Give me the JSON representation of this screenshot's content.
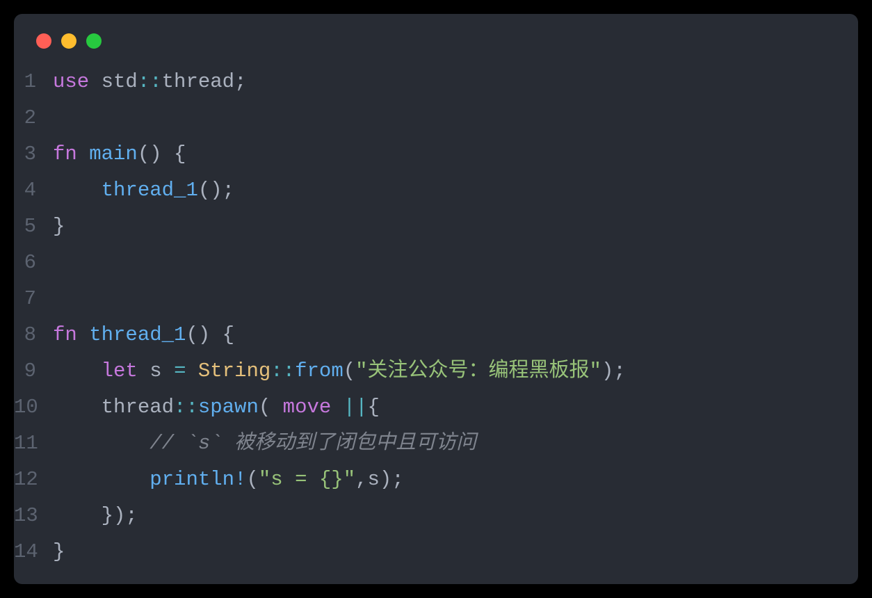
{
  "window": {
    "dots": [
      "red",
      "yellow",
      "green"
    ]
  },
  "code": {
    "lines": [
      {
        "n": "1",
        "tokens": [
          {
            "c": "keyword",
            "t": "use"
          },
          {
            "c": "punct",
            "t": " std"
          },
          {
            "c": "op",
            "t": "::"
          },
          {
            "c": "ident",
            "t": "thread"
          },
          {
            "c": "punct",
            "t": ";"
          }
        ]
      },
      {
        "n": "2",
        "tokens": []
      },
      {
        "n": "3",
        "tokens": [
          {
            "c": "keyword",
            "t": "fn"
          },
          {
            "c": "punct",
            "t": " "
          },
          {
            "c": "func",
            "t": "main"
          },
          {
            "c": "punct",
            "t": "() {"
          }
        ]
      },
      {
        "n": "4",
        "tokens": [
          {
            "c": "punct",
            "t": "    "
          },
          {
            "c": "func",
            "t": "thread_1"
          },
          {
            "c": "punct",
            "t": "();"
          }
        ]
      },
      {
        "n": "5",
        "tokens": [
          {
            "c": "punct",
            "t": "}"
          }
        ]
      },
      {
        "n": "6",
        "tokens": []
      },
      {
        "n": "7",
        "tokens": []
      },
      {
        "n": "8",
        "tokens": [
          {
            "c": "keyword",
            "t": "fn"
          },
          {
            "c": "punct",
            "t": " "
          },
          {
            "c": "func",
            "t": "thread_1"
          },
          {
            "c": "punct",
            "t": "() {"
          }
        ]
      },
      {
        "n": "9",
        "tokens": [
          {
            "c": "punct",
            "t": "    "
          },
          {
            "c": "keyword",
            "t": "let"
          },
          {
            "c": "punct",
            "t": " s "
          },
          {
            "c": "op",
            "t": "="
          },
          {
            "c": "punct",
            "t": " "
          },
          {
            "c": "type",
            "t": "String"
          },
          {
            "c": "op",
            "t": "::"
          },
          {
            "c": "func",
            "t": "from"
          },
          {
            "c": "punct",
            "t": "("
          },
          {
            "c": "string",
            "t": "\"关注公众号：编程黑板报\""
          },
          {
            "c": "punct",
            "t": ");"
          }
        ]
      },
      {
        "n": "10",
        "tokens": [
          {
            "c": "punct",
            "t": "    thread"
          },
          {
            "c": "op",
            "t": "::"
          },
          {
            "c": "func",
            "t": "spawn"
          },
          {
            "c": "punct",
            "t": "( "
          },
          {
            "c": "keyword",
            "t": "move"
          },
          {
            "c": "punct",
            "t": " "
          },
          {
            "c": "op",
            "t": "||"
          },
          {
            "c": "punct",
            "t": "{"
          }
        ]
      },
      {
        "n": "11",
        "tokens": [
          {
            "c": "punct",
            "t": "        "
          },
          {
            "c": "comment",
            "t": "// `s` 被移动到了闭包中且可访问"
          }
        ]
      },
      {
        "n": "12",
        "tokens": [
          {
            "c": "punct",
            "t": "        "
          },
          {
            "c": "func",
            "t": "println!"
          },
          {
            "c": "punct",
            "t": "("
          },
          {
            "c": "string",
            "t": "\"s = {}\""
          },
          {
            "c": "punct",
            "t": ",s);"
          }
        ]
      },
      {
        "n": "13",
        "tokens": [
          {
            "c": "punct",
            "t": "    });"
          }
        ]
      },
      {
        "n": "14",
        "tokens": [
          {
            "c": "punct",
            "t": "}"
          }
        ]
      }
    ]
  }
}
